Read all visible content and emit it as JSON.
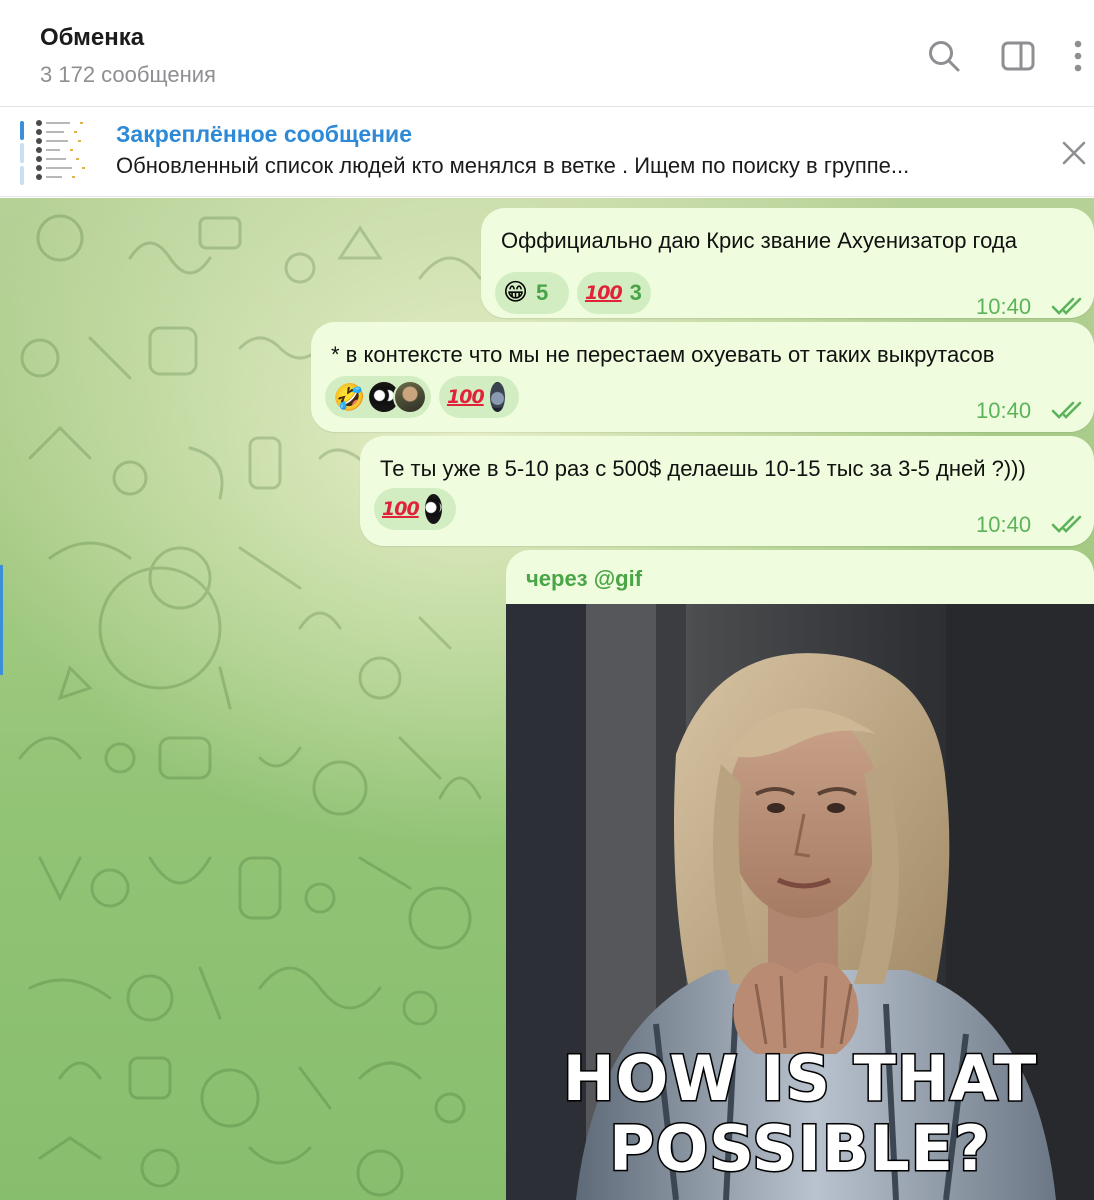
{
  "header": {
    "title": "Обменка",
    "subtitle": "3 172 сообщения",
    "icons": [
      "search-icon",
      "sidebar-toggle-icon",
      "more-icon"
    ]
  },
  "pinned": {
    "title": "Закреплённое сообщение",
    "text": "Обновленный список людей кто менялся в ветке . Ищем по поиску в группе..."
  },
  "messages": [
    {
      "text": "Оффициально даю Крис звание Ахуенизатор года",
      "time": "10:40",
      "reactions": [
        {
          "emoji": "😁",
          "count": "5"
        },
        {
          "emoji": "💯",
          "count": "3"
        }
      ]
    },
    {
      "text": "* в контексте что мы не перестаем охуевать от таких выкрутасов",
      "time": "10:40",
      "reactions": [
        {
          "emoji": "🤣",
          "avatars": [
            "owl-avatar",
            "soldier-avatar"
          ]
        },
        {
          "emoji": "💯",
          "avatars": [
            "gorilla-avatar"
          ]
        }
      ]
    },
    {
      "text": "Те ты уже в 5-10 раз с 500$ делаешь 10-15 тыс за 3-5 дней ?)))",
      "time": "10:40",
      "reactions": [
        {
          "emoji": "💯",
          "avatars": [
            "owl-avatar"
          ]
        }
      ]
    },
    {
      "via": "через @gif",
      "gif_caption_line1": "HOW IS THAT",
      "gif_caption_line2": "POSSIBLE?"
    }
  ],
  "colors": {
    "accent": "#2e8ad6",
    "bubble": "#effdde",
    "time_green": "#5db35b",
    "reaction_bg": "#d3edc2"
  }
}
